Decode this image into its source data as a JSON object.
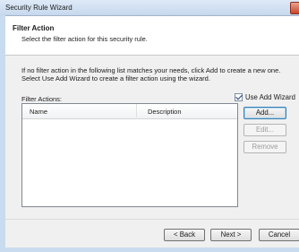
{
  "window": {
    "title": "Security Rule Wizard"
  },
  "header": {
    "title": "Filter Action",
    "subtitle": "Select the filter action for this security rule."
  },
  "instructions": {
    "line1": "If no filter action in the following list matches your needs, click Add to create a new one.",
    "line2": "Select Use Add Wizard to create a filter action using the wizard."
  },
  "filter_actions": {
    "label": "Filter Actions:",
    "use_wizard_label": "Use Add Wizard",
    "use_wizard_checked": true,
    "columns": [
      "Name",
      "Description"
    ],
    "rows": []
  },
  "buttons": {
    "add": "Add...",
    "edit": "Edit...",
    "remove": "Remove",
    "back": "< Back",
    "next": "Next >",
    "cancel": "Cancel"
  }
}
